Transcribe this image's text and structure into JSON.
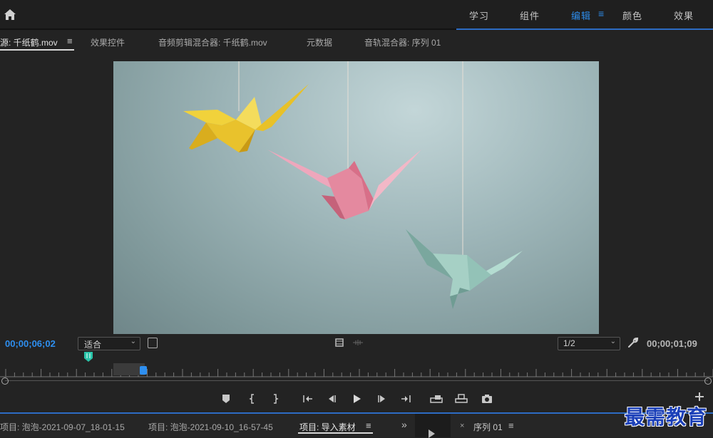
{
  "workspace_tabs": [
    "学习",
    "组件",
    "编辑",
    "颜色",
    "效果"
  ],
  "panel_tabs": {
    "source": "源: 千纸鹤.mov",
    "effect_controls": "效果控件",
    "audio_clip_mixer": "音频剪辑混合器: 千纸鹤.mov",
    "metadata": "元数据",
    "audio_track_mixer": "音轨混合器: 序列 01"
  },
  "monitor": {
    "playhead_timecode": "00;00;06;02",
    "zoom_value": "适合",
    "resolution_value": "1/2",
    "duration_timecode": "00;00;01;09"
  },
  "bottom_tabs": {
    "project1": "项目: 泡泡-2021-09-07_18-01-15",
    "project2": "项目: 泡泡-2021-09-10_16-57-45",
    "project_import": "项目: 导入素材",
    "sequence": "序列 01"
  },
  "icons": {
    "home": "home-icon",
    "menu": "hamburger-menu-icon",
    "wrench": "wrench-icon",
    "film": "film-icon",
    "camera": "camera-icon"
  },
  "colors": {
    "accent": "#2d8ceb",
    "background": "#232323"
  },
  "watermark": "最需教育"
}
